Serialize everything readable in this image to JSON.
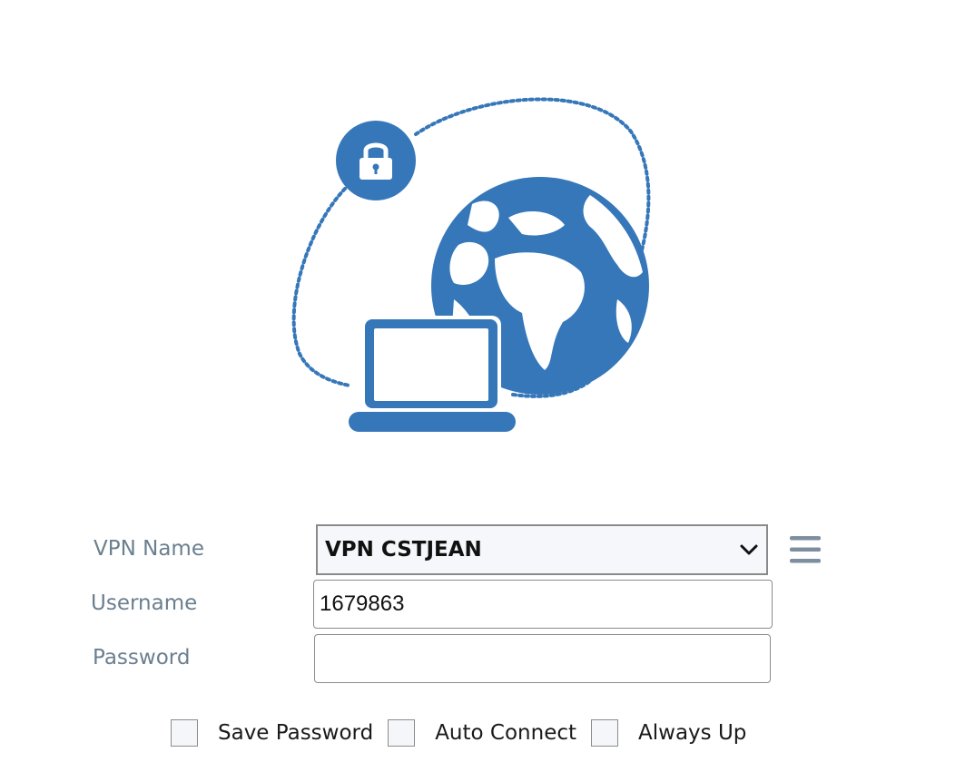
{
  "illustration": {
    "accent_color": "#3577b9",
    "icons": [
      "lock-icon",
      "globe-icon",
      "laptop-icon"
    ]
  },
  "form": {
    "vpn_name_label": "VPN Name",
    "vpn_name_value": "VPN CSTJEAN",
    "username_label": "Username",
    "username_value": "1679863",
    "password_label": "Password",
    "password_value": ""
  },
  "options": {
    "save_password_label": "Save Password",
    "auto_connect_label": "Auto Connect",
    "always_up_label": "Always Up"
  },
  "colors": {
    "label": "#6b7f8f",
    "menu_icon": "#7d8f9e",
    "select_bg": "#f5f7fa"
  }
}
